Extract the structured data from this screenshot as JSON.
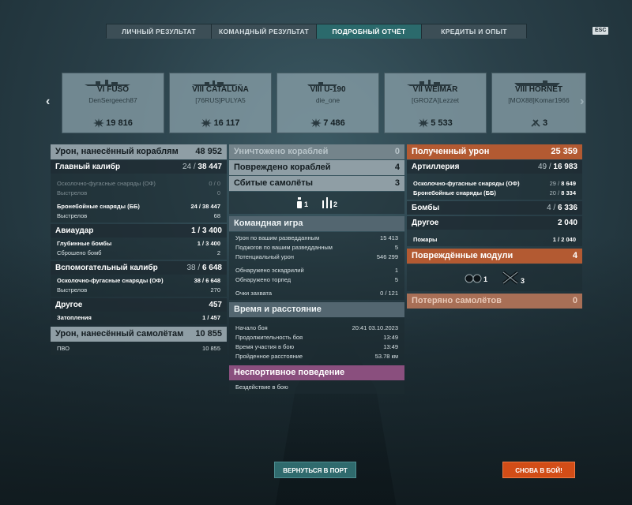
{
  "tabs": [
    {
      "label": "ЛИЧНЫЙ РЕЗУЛЬТАТ"
    },
    {
      "label": "КОМАНДНЫЙ РЕЗУЛЬТАТ"
    },
    {
      "label": "ПОДРОБНЫЙ ОТЧЁТ"
    },
    {
      "label": "КРЕДИТЫ И ОПЫТ"
    }
  ],
  "esc_label": "ESC",
  "ships": [
    {
      "name": "VI FUSŌ",
      "player": "DenSergeech87",
      "value": "19 816",
      "icon": "damage-burst-icon"
    },
    {
      "name": "VIII CATALUÑA",
      "player": "[76RUS]PULYA5",
      "value": "16 117",
      "icon": "damage-burst-icon"
    },
    {
      "name": "VIII U-190",
      "player": "die_one",
      "value": "7 486",
      "icon": "damage-burst-icon"
    },
    {
      "name": "VII WEIMAR",
      "player": "[GROZA]Lezzet",
      "value": "5 533",
      "icon": "damage-burst-icon"
    },
    {
      "name": "VIII HORNET",
      "player": "[MOX88]Komar1966",
      "value": "3",
      "icon": "plane-shot-down-icon"
    }
  ],
  "damage_dealt": {
    "title": "Урон, нанесённый кораблям",
    "value": "48 952",
    "main_battery": {
      "label": "Главный калибр",
      "hits": "24",
      "value": "38 447"
    },
    "he_shells": {
      "label": "Осколочно-фугасные снаряды (ОФ)",
      "value": "0 / 0"
    },
    "he_shots": {
      "label": "Выстрелов",
      "value": "0"
    },
    "ap_shells": {
      "label": "Бронебойные снаряды (ББ)",
      "value": "24 / 38 447"
    },
    "ap_shots": {
      "label": "Выстрелов",
      "value": "68"
    },
    "airstrike": {
      "label": "Авиаудар",
      "hits": "1",
      "value": "3 400"
    },
    "depth_charges": {
      "label": "Глубинные бомбы",
      "value": "1 / 3 400"
    },
    "bombs_dropped": {
      "label": "Сброшено бомб",
      "value": "2"
    },
    "secondary": {
      "label": "Вспомогательный калибр",
      "hits": "38",
      "value": "6 648"
    },
    "sec_he": {
      "label": "Осколочно-фугасные снаряды (ОФ)",
      "value": "38 / 6 648"
    },
    "sec_shots": {
      "label": "Выстрелов",
      "value": "270"
    },
    "other": {
      "label": "Другое",
      "value": "457"
    },
    "flooding": {
      "label": "Затопления",
      "value": "1 / 457"
    }
  },
  "aircraft_damage": {
    "title": "Урон, нанесённый самолётам",
    "value": "10 855",
    "aa_label": "ПВО",
    "aa_value": "10 855"
  },
  "middle": {
    "destroyed": {
      "label": "Уничтожено кораблей",
      "value": "0"
    },
    "damaged": {
      "label": "Повреждено кораблей",
      "value": "4"
    },
    "planes_shot": {
      "label": "Сбитые самолёты",
      "value": "3"
    },
    "plane_icons": [
      {
        "icon": "plane-single-icon",
        "count": "1"
      },
      {
        "icon": "plane-squadron-icon",
        "count": "2"
      }
    ],
    "teamplay": {
      "title": "Командная игра",
      "rows": [
        {
          "label": "Урон по вашим разведданным",
          "value": "15 413"
        },
        {
          "label": "Поджогов по вашим разведданным",
          "value": "5"
        },
        {
          "label": "Потенциальный урон",
          "value": "546 299"
        },
        {
          "label": "Обнаружено эскадрилий",
          "value": "1"
        },
        {
          "label": "Обнаружено торпед",
          "value": "5"
        },
        {
          "label": "Очки захвата",
          "value": "0 / 121"
        }
      ]
    },
    "time": {
      "title": "Время и расстояние",
      "rows": [
        {
          "label": "Начало боя",
          "value": "20:41  03.10.2023"
        },
        {
          "label": "Продолжительность боя",
          "value": "13:49"
        },
        {
          "label": "Время участия в бою",
          "value": "13:49"
        },
        {
          "label": "Пройденное расстояние",
          "value": "53.78 км"
        }
      ]
    },
    "unsporting": {
      "title": "Неспортивное поведение",
      "rows": [
        {
          "label": "Бездействие в бою",
          "value": ""
        }
      ]
    }
  },
  "received": {
    "title": "Полученный урон",
    "value": "25 359",
    "artillery": {
      "label": "Артиллерия",
      "hits": "49",
      "value": "16 983"
    },
    "he": {
      "label": "Осколочно-фугасные снаряды (ОФ)",
      "hits": "29",
      "value": "8 649"
    },
    "ap": {
      "label": "Бронебойные снаряды (ББ)",
      "hits": "20",
      "value": "8 334"
    },
    "bombs": {
      "label": "Бомбы",
      "hits": "4",
      "value": "6 336"
    },
    "other": {
      "label": "Другое",
      "value": "2 040"
    },
    "fires": {
      "label": "Пожары",
      "value": "1 / 2 040"
    },
    "modules": {
      "title": "Повреждённые модули",
      "value": "4",
      "items": [
        {
          "icon": "engine-module-icon",
          "count": "1"
        },
        {
          "icon": "steering-module-icon",
          "count": "3"
        }
      ]
    },
    "lost_planes": {
      "label": "Потеряно самолётов",
      "value": "0"
    }
  },
  "buttons": {
    "port": "ВЕРНУТЬСЯ В ПОРТ",
    "battle": "СНОВА В БОЙ!"
  },
  "colors": {
    "active_tab": "#2b6a6c",
    "received_header": "#b35a32",
    "unsporting_header": "#8a4f7e",
    "battle_button": "#d24d17"
  }
}
